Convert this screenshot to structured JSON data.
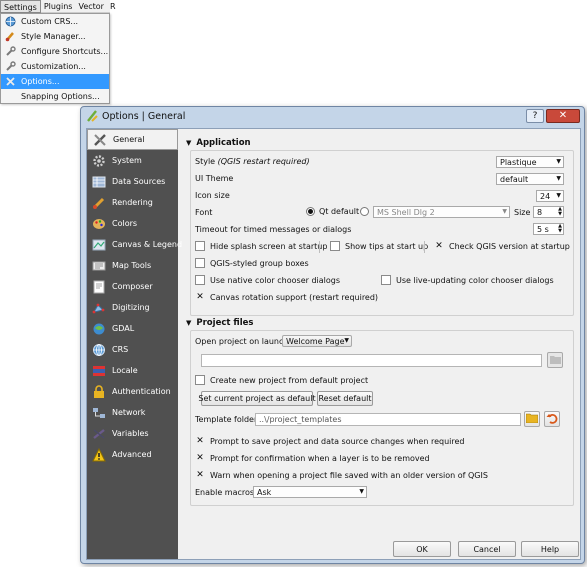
{
  "menubar": {
    "items": [
      "Settings",
      "Plugins",
      "Vector",
      "R"
    ]
  },
  "settings_menu": {
    "items": [
      {
        "label": "Custom CRS...",
        "icon": "globe-icon"
      },
      {
        "label": "Style Manager...",
        "icon": "brush-icon"
      },
      {
        "label": "Configure Shortcuts...",
        "icon": "wrench-icon"
      },
      {
        "label": "Customization...",
        "icon": "wrench-icon"
      },
      {
        "label": "Options...",
        "icon": "tools-icon",
        "selected": true
      },
      {
        "label": "Snapping Options...",
        "icon": ""
      }
    ]
  },
  "dialog": {
    "title": "Options | General",
    "help_glyph": "?",
    "close_glyph": "✕"
  },
  "sidebar": {
    "items": [
      {
        "label": "General",
        "icon": "tools-icon"
      },
      {
        "label": "System",
        "icon": "gear-icon"
      },
      {
        "label": "Data Sources",
        "icon": "table-icon"
      },
      {
        "label": "Rendering",
        "icon": "brush-icon"
      },
      {
        "label": "Colors",
        "icon": "palette-icon"
      },
      {
        "label": "Canvas & Legend",
        "icon": "canvas-icon"
      },
      {
        "label": "Map Tools",
        "icon": "map-tools-icon"
      },
      {
        "label": "Composer",
        "icon": "composer-icon"
      },
      {
        "label": "Digitizing",
        "icon": "digitizing-icon"
      },
      {
        "label": "GDAL",
        "icon": "gdal-icon"
      },
      {
        "label": "CRS",
        "icon": "globe-icon"
      },
      {
        "label": "Locale",
        "icon": "flag-icon"
      },
      {
        "label": "Authentication",
        "icon": "lock-icon"
      },
      {
        "label": "Network",
        "icon": "network-icon"
      },
      {
        "label": "Variables",
        "icon": "variables-icon"
      },
      {
        "label": "Advanced",
        "icon": "warning-icon"
      }
    ]
  },
  "application": {
    "header": "Application",
    "style_label": "Style",
    "style_note": "(QGIS restart required)",
    "style_value": "Plastique",
    "ui_theme_label": "UI Theme",
    "ui_theme_value": "default",
    "icon_size_label": "Icon size",
    "icon_size_value": "24",
    "font_label": "Font",
    "font_qt_default": "Qt default",
    "font_custom_value": "MS Shell Dlg 2",
    "font_size_label": "Size",
    "font_size_value": "8",
    "timeout_label": "Timeout for timed messages or dialogs",
    "timeout_value": "5 s",
    "hide_splash": "Hide splash screen at startup",
    "show_tips": "Show tips at start up",
    "check_version": "Check QGIS version at startup",
    "styled_group_boxes": "QGIS-styled group boxes",
    "native_color_chooser": "Use native color chooser dialogs",
    "live_color_chooser": "Use live-updating color chooser dialogs",
    "canvas_rotation": "Canvas rotation support (restart required)"
  },
  "project_files": {
    "header": "Project files",
    "open_on_launch_label": "Open project on launch",
    "open_on_launch_value": "Welcome Page",
    "create_from_default": "Create new project from default project",
    "set_current_default": "Set current project as default",
    "reset_default": "Reset default",
    "template_folder_label": "Template folder",
    "template_folder_value": "..\\/project_templates",
    "prompt_save": "Prompt to save project and data source changes when required",
    "prompt_remove_layer": "Prompt for confirmation when a layer is to be removed",
    "warn_older_version": "Warn when opening a project file saved with an older version of QGIS",
    "enable_macros_label": "Enable macros",
    "enable_macros_value": "Ask"
  },
  "buttons": {
    "ok": "OK",
    "cancel": "Cancel",
    "help": "Help"
  },
  "colors": {
    "selection": "#3399ff",
    "sidebar_bg": "#505050",
    "dialog_frame": "#c4d5e8"
  }
}
